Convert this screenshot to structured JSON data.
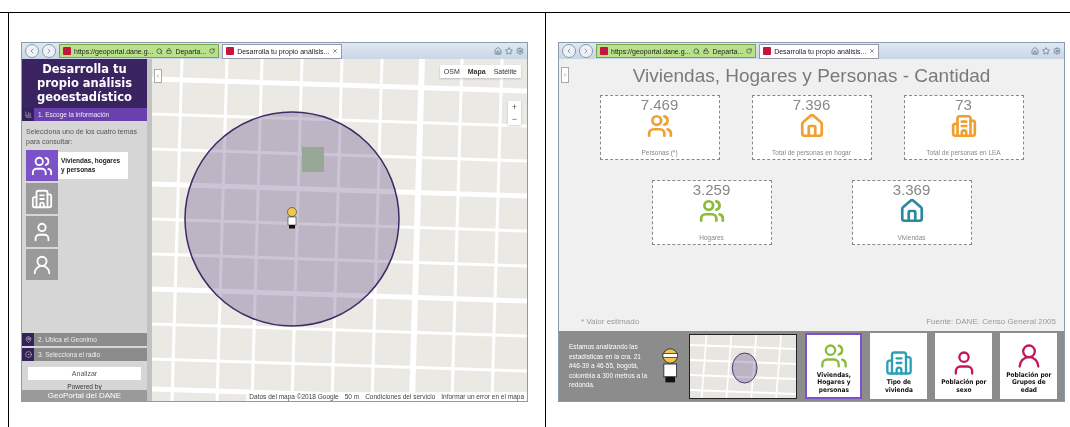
{
  "browsers": [
    {
      "kind": "builder",
      "address": "https://geoportal.dane.g...",
      "site": "Departa...",
      "tab": "Desarrolla tu propio análisis...",
      "sidebar": {
        "title": "Desarrolla tu propio análisis geoestadístico",
        "steps": [
          {
            "label": "1. Escoge la información",
            "selected": true
          },
          {
            "label": "2. Ubica el Geonimo",
            "selected": false
          },
          {
            "label": "3. Selecciona el radio",
            "selected": false
          }
        ],
        "prompt": "Selecciona uno de los cuatro temas para consultar:",
        "themes": [
          {
            "kind": "households",
            "label": "Viviendas, hogares y personas",
            "selected": true
          },
          {
            "kind": "dwelling",
            "selected": false
          },
          {
            "kind": "sex",
            "selected": false
          },
          {
            "kind": "age",
            "selected": false
          }
        ],
        "button": "Analizar",
        "powered_by": "Powered by",
        "brand": "GeoPortal del DANE"
      },
      "map": {
        "types": [
          {
            "label": "OSM",
            "selected": false
          },
          {
            "label": "Mapa",
            "selected": true
          },
          {
            "label": "Satélite",
            "selected": false
          }
        ],
        "zoom": [
          "+",
          "−"
        ],
        "attribution": [
          "Datos del mapa ©2018 Google",
          "50 m",
          "Condiciones del servicio",
          "Informar un error en el mapa"
        ]
      }
    },
    {
      "kind": "results",
      "address": "https://geoportal.dane.g...",
      "site": "Departa...",
      "tab": "Desarrolla tu propio análisis...",
      "title": "Viviendas, Hogares y Personas - Cantidad",
      "cards": [
        {
          "value": "7.469",
          "label": "Personas (*)",
          "color": "#f0a030"
        },
        {
          "value": "7.396",
          "label": "Total de personas en hogar",
          "color": "#f0a030"
        },
        {
          "value": "73",
          "label": "Total de personas en LEA",
          "color": "#f0a030"
        },
        {
          "value": "3.259",
          "label": "Hogares",
          "color": "#8cba3a"
        },
        {
          "value": "3.369",
          "label": "Viviendas",
          "color": "#2a8a9c"
        }
      ],
      "note": "* Valor estimado",
      "source": "Fuente: DANE. Censo General 2005",
      "summary": "Estamos analizando las estadísticas en la cra. 21 #46-39 a 46-55, bogotá, colombia a 300 metros a la redonda.",
      "themes": [
        {
          "kind": "households",
          "label": "Viviendas, Hogares y personas",
          "selected": true
        },
        {
          "kind": "dwelling",
          "label": "Tipo de vivienda",
          "selected": false
        },
        {
          "kind": "sex",
          "label": "Población por sexo",
          "selected": false
        },
        {
          "kind": "age",
          "label": "Población por Grupos de edad",
          "selected": false
        }
      ]
    }
  ]
}
